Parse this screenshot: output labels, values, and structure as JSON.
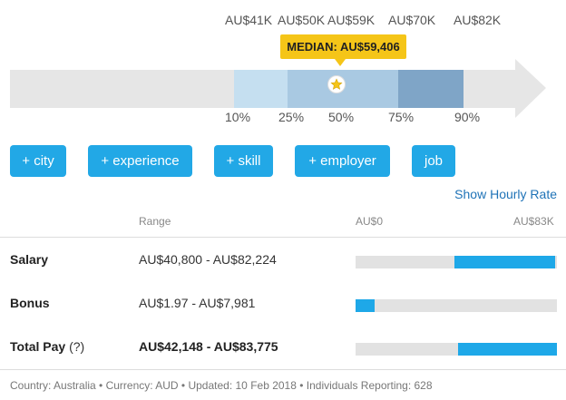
{
  "chart": {
    "top_labels": [
      "AU$41K",
      "AU$50K",
      "AU$59K",
      "AU$70K",
      "AU$82K"
    ],
    "bottom_labels": [
      "10%",
      "25%",
      "50%",
      "75%",
      "90%"
    ],
    "median_label": "MEDIAN: AU$59,406",
    "colors": {
      "band_outer": "#c5dff0",
      "band_mid": "#a9c9e2",
      "band_inner": "#7fa5c7",
      "arrow_bg": "#e6e6e6",
      "median": "#f5c518"
    }
  },
  "chart_data": {
    "type": "bar",
    "title": "",
    "categories": [
      "10%",
      "25%",
      "50%",
      "75%",
      "90%"
    ],
    "values": [
      41000,
      50000,
      59406,
      70000,
      82000
    ],
    "value_labels": [
      "AU$41K",
      "AU$50K",
      "AU$59K",
      "AU$70K",
      "AU$82K"
    ],
    "median": 59406
  },
  "filters": [
    "+ city",
    "+ experience",
    "+ skill",
    "+ employer",
    "job"
  ],
  "hourly_link": "Show Hourly Rate",
  "table": {
    "range_header": "Range",
    "axis_min": "AU$0",
    "axis_max": "AU$83K",
    "axis_max_value": 83000,
    "rows": [
      {
        "label": "Salary",
        "range": "AU$40,800 - AU$82,224",
        "low": 40800,
        "high": 82224
      },
      {
        "label": "Bonus",
        "range": "AU$1.97 - AU$7,981",
        "low": 1.97,
        "high": 7981
      },
      {
        "label": "Total Pay",
        "help": "(?)",
        "range": "AU$42,148 - AU$83,775",
        "low": 42148,
        "high": 83775
      }
    ]
  },
  "footer": "Country: Australia • Currency: AUD • Updated: 10 Feb 2018 • Individuals Reporting: 628",
  "icons": {
    "median_marker": "star-icon"
  }
}
